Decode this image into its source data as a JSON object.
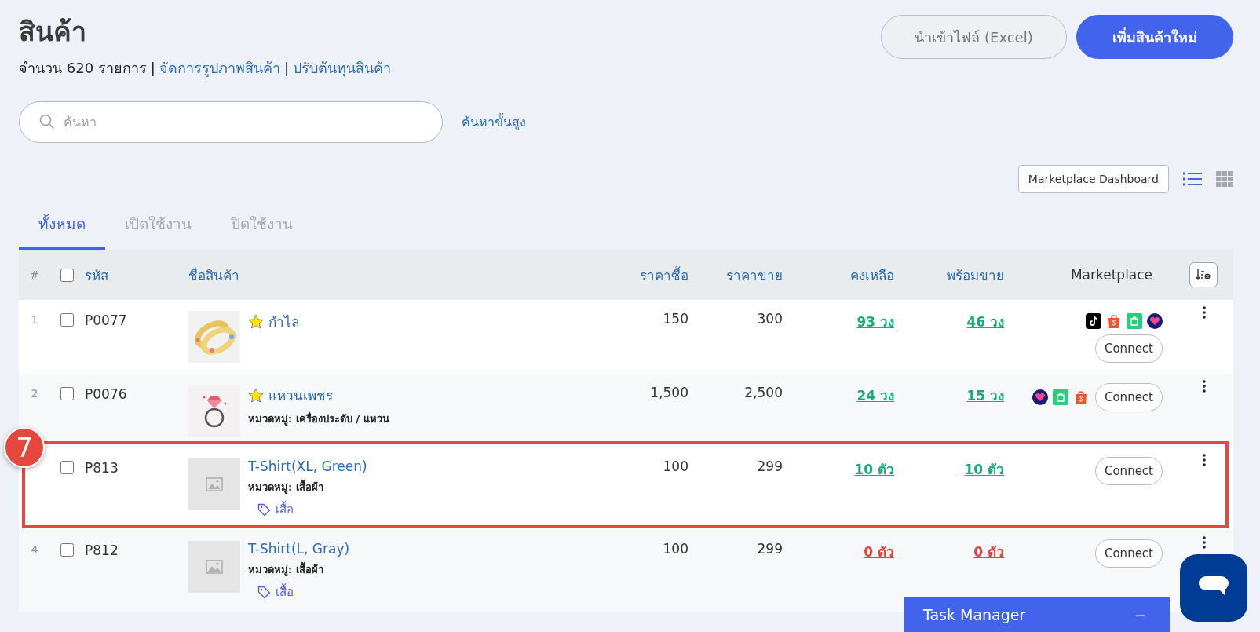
{
  "header": {
    "title": "สินค้า",
    "count_text": "จำนวน 620 รายการ",
    "separator_1": "|",
    "link_images": "จัดการรูปภาพสินค้า",
    "separator_2": "|",
    "link_cost": "ปรับต้นทุนสินค้า"
  },
  "actions": [
    {
      "label": "นำเข้าไฟล์ (Excel)",
      "kind": "secondary"
    },
    {
      "label": "เพิ่มสินค้าใหม่",
      "kind": "primary"
    }
  ],
  "search": {
    "placeholder": "ค้นหา",
    "advanced_link": "ค้นหาขั้นสูง"
  },
  "toolbar": {
    "dashboard_button": "Marketplace Dashboard",
    "views": [
      {
        "kind": "list",
        "selected": true
      },
      {
        "kind": "grid",
        "selected": false
      }
    ]
  },
  "tabs": [
    {
      "label": "ทั้งหมด",
      "selected": true
    },
    {
      "label": "เปิดใช้งาน",
      "selected": false
    },
    {
      "label": "ปิดใช้งาน",
      "selected": false
    }
  ],
  "table": {
    "columns": {
      "index": "#",
      "select_all_checked": false,
      "code": "รหัส",
      "name": "ชื่อสินค้า",
      "buy": "ราคาซื้อ",
      "sell": "ราคาขาย",
      "stock": "คงเหลือ",
      "ready": "พร้อมขาย",
      "marketplace": "Marketplace"
    },
    "rows": [
      {
        "index": "1",
        "checked": false,
        "code": "P0077",
        "image": {
          "kind": "picture"
        },
        "starred": true,
        "name": "กำไล",
        "buy": "150",
        "sell": "300",
        "stock": {
          "text": "93 วง",
          "color": "#1aa97a"
        },
        "ready": {
          "text": "46 วง",
          "color": "#1aa97a"
        },
        "marketplaces": [
          {
            "kind": "tiktok"
          },
          {
            "kind": "shopee"
          },
          {
            "kind": "line"
          },
          {
            "kind": "lazada"
          }
        ],
        "connect": "Connect",
        "highlighted": false
      },
      {
        "index": "2",
        "checked": false,
        "code": "P0076",
        "image": {
          "kind": "picture"
        },
        "starred": true,
        "name": "แหวนเพชร",
        "category": "หมวดหมู่: เครื่องประดับ / แหวน",
        "buy": "1,500",
        "sell": "2,500",
        "stock": {
          "text": "24 วง",
          "color": "#1aa97a"
        },
        "ready": {
          "text": "15 วง",
          "color": "#1aa97a"
        },
        "marketplaces": [
          {
            "kind": "lazada"
          },
          {
            "kind": "line"
          },
          {
            "kind": "shopee"
          }
        ],
        "connect": "Connect",
        "highlighted": false
      },
      {
        "checked": false,
        "code": "P813",
        "image": {
          "kind": "placeholder"
        },
        "starred": false,
        "name": "T-Shirt(XL, Green)",
        "category": "หมวดหมู่: เสื้อผ้า",
        "tags": [
          "เสื้อ"
        ],
        "buy": "100",
        "sell": "299",
        "stock": {
          "text": "10 ตัว",
          "color": "#1aa97a"
        },
        "ready": {
          "text": "10 ตัว",
          "color": "#1aa97a"
        },
        "connect": "Connect",
        "highlighted": true,
        "step": "7"
      },
      {
        "index": "4",
        "checked": false,
        "code": "P812",
        "image": {
          "kind": "placeholder"
        },
        "starred": false,
        "name": "T-Shirt(L, Gray)",
        "category": "หมวดหมู่: เสื้อผ้า",
        "tags": [
          "เสื้อ"
        ],
        "buy": "100",
        "sell": "299",
        "stock": {
          "text": "0 ตัว",
          "color": "#e53e3e"
        },
        "ready": {
          "text": "0 ตัว",
          "color": "#e53e3e"
        },
        "connect": "Connect",
        "highlighted": false
      }
    ]
  },
  "task_manager": {
    "title": "Task Manager",
    "minimize": "−"
  }
}
